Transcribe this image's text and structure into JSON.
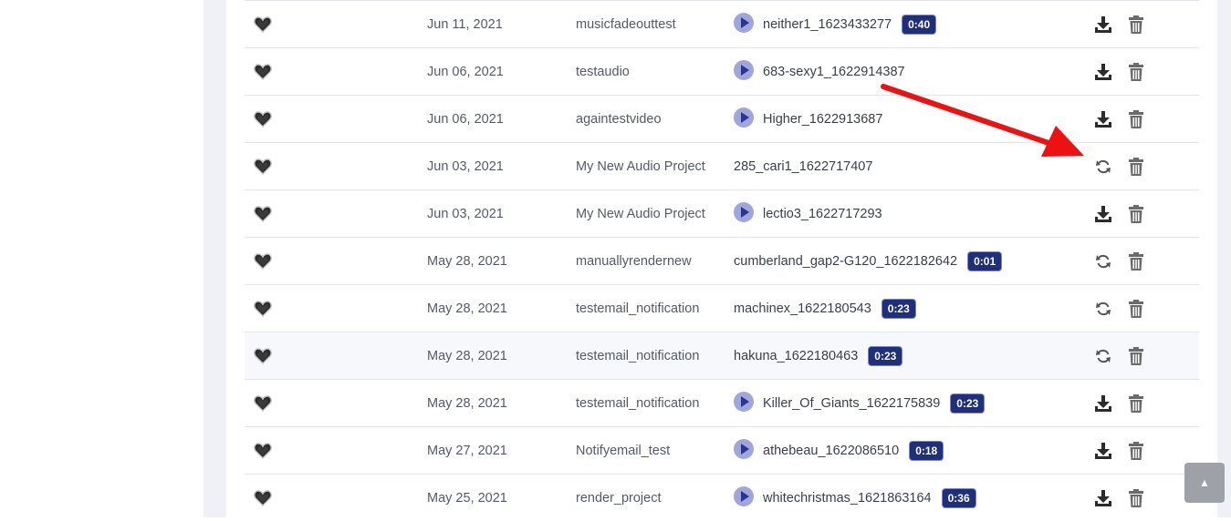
{
  "rows": [
    {
      "date": "Jun 11, 2021",
      "project": "musicfadeouttest",
      "file": "neither1_1623433277",
      "duration": "0:40",
      "playable": true,
      "action": "download"
    },
    {
      "date": "Jun 06, 2021",
      "project": "testaudio",
      "file": "683-sexy1_1622914387",
      "duration": "",
      "playable": true,
      "action": "download"
    },
    {
      "date": "Jun 06, 2021",
      "project": "againtestvideo",
      "file": "Higher_1622913687",
      "duration": "",
      "playable": true,
      "action": "download"
    },
    {
      "date": "Jun 03, 2021",
      "project": "My New Audio Project",
      "file": "285_cari1_1622717407",
      "duration": "",
      "playable": false,
      "action": "refresh"
    },
    {
      "date": "Jun 03, 2021",
      "project": "My New Audio Project",
      "file": "lectio3_1622717293",
      "duration": "",
      "playable": true,
      "action": "download"
    },
    {
      "date": "May 28, 2021",
      "project": "manuallyrendernew",
      "file": "cumberland_gap2-G120_1622182642",
      "duration": "0:01",
      "playable": false,
      "action": "refresh"
    },
    {
      "date": "May 28, 2021",
      "project": "testemail_notification",
      "file": "machinex_1622180543",
      "duration": "0:23",
      "playable": false,
      "action": "refresh"
    },
    {
      "date": "May 28, 2021",
      "project": "testemail_notification",
      "file": "hakuna_1622180463",
      "duration": "0:23",
      "playable": false,
      "action": "refresh"
    },
    {
      "date": "May 28, 2021",
      "project": "testemail_notification",
      "file": "Killer_Of_Giants_1622175839",
      "duration": "0:23",
      "playable": true,
      "action": "download"
    },
    {
      "date": "May 27, 2021",
      "project": "Notifyemail_test",
      "file": "athebeau_1622086510",
      "duration": "0:18",
      "playable": true,
      "action": "download"
    },
    {
      "date": "May 25, 2021",
      "project": "render_project",
      "file": "whitechristmas_1621863164",
      "duration": "0:36",
      "playable": true,
      "action": "download"
    }
  ],
  "icons": {
    "favorite": "heart-icon",
    "play": "play-icon",
    "download": "download-icon",
    "refresh": "refresh-icon",
    "delete": "trash-icon",
    "scroll_top": "chevron-up-icon"
  },
  "colors": {
    "duration_badge": "#1f2f7a",
    "play_circle": "#9fa6d9",
    "annotation_arrow": "#ee1111"
  },
  "scroll_top_glyph": "▲"
}
